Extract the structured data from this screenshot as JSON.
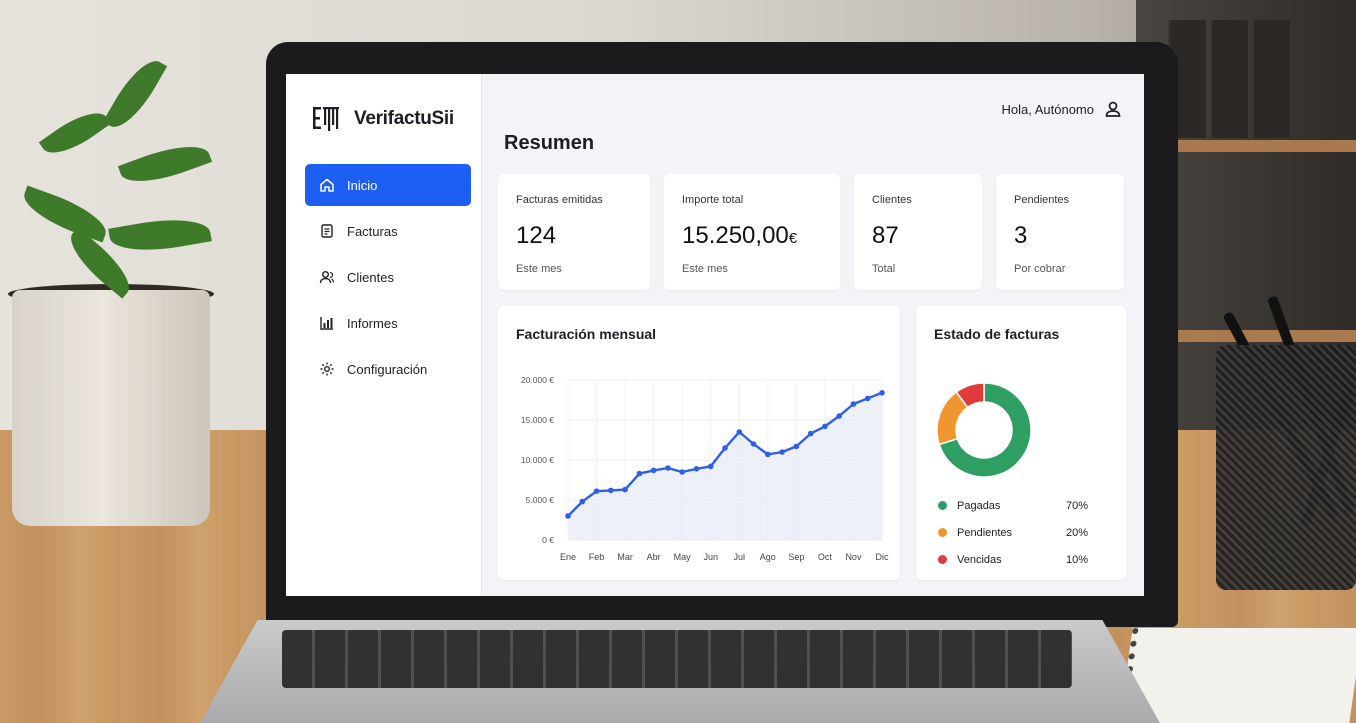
{
  "app": {
    "brand": "VerifactuSii",
    "greeting": "Hola, Autónomo",
    "page_title": "Resumen"
  },
  "sidebar": {
    "items": [
      {
        "label": "Inicio",
        "icon": "home-icon",
        "active": true
      },
      {
        "label": "Facturas",
        "icon": "invoice-icon",
        "active": false
      },
      {
        "label": "Clientes",
        "icon": "users-icon",
        "active": false
      },
      {
        "label": "Informes",
        "icon": "chart-bar-icon",
        "active": false
      },
      {
        "label": "Configuración",
        "icon": "gear-icon",
        "active": false
      }
    ]
  },
  "stats": [
    {
      "label": "Facturas emitidas",
      "value": "124",
      "unit": "",
      "sub": "Este mes"
    },
    {
      "label": "Importe total",
      "value": "15.250,00",
      "unit": "€",
      "sub": "Este mes"
    },
    {
      "label": "Clientes",
      "value": "87",
      "unit": "",
      "sub": "Total"
    },
    {
      "label": "Pendientes",
      "value": "3",
      "unit": "",
      "sub": "Por cobrar"
    }
  ],
  "line_card": {
    "title": "Facturación mensual"
  },
  "donut_card": {
    "title": "Estado de facturas"
  },
  "colors": {
    "accent": "#1d5ff2",
    "line": "#2f5fe6",
    "pagadas": "#2e9e63",
    "pendientes": "#f0962f",
    "vencidas": "#e23a3a"
  },
  "chart_data": [
    {
      "type": "line",
      "title": "Facturación mensual",
      "categories": [
        "Ene",
        "Feb",
        "Mar",
        "Abr",
        "May",
        "Jun",
        "Jul",
        "Ago",
        "Sep",
        "Oct",
        "Nov",
        "Dic"
      ],
      "x": [
        0,
        0.5,
        1,
        1.5,
        2,
        2.5,
        3,
        3.5,
        4,
        4.5,
        5,
        5.5,
        6,
        6.5,
        7,
        7.5,
        8,
        8.5,
        9,
        9.5,
        10,
        10.5,
        11
      ],
      "values": [
        3000,
        4800,
        6100,
        6200,
        6300,
        8300,
        8700,
        9000,
        8500,
        8900,
        9200,
        11500,
        13500,
        12000,
        10700,
        11000,
        11700,
        13300,
        14200,
        15500,
        17000,
        17700,
        18400
      ],
      "ylim": [
        0,
        20000
      ],
      "yticks": [
        "0 €",
        "5.000 €",
        "10.000 €",
        "15.000 €",
        "20.000 €"
      ],
      "ytick_values": [
        0,
        5000,
        10000,
        15000,
        20000
      ],
      "grid": true,
      "area": true
    },
    {
      "type": "pie",
      "title": "Estado de facturas",
      "labels": [
        "Pagadas",
        "Pendientes",
        "Vencidas"
      ],
      "values": [
        70,
        20,
        10
      ],
      "display": [
        "70%",
        "20%",
        "10%"
      ],
      "donut": true
    }
  ]
}
